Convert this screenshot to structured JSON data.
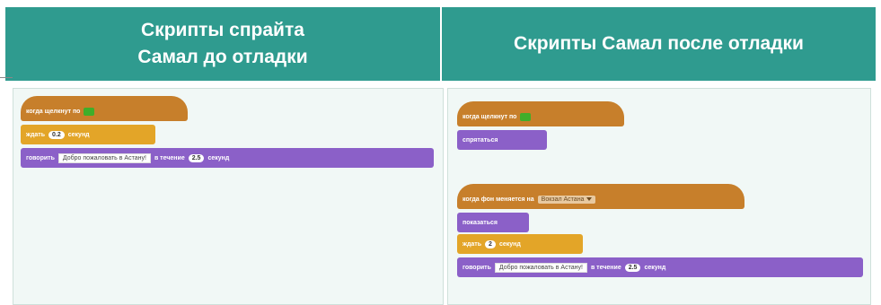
{
  "headers": {
    "left_line1": "Скрипты спрайта",
    "left_line2": "Самал до отладки",
    "right": "Скрипты Самал после отладки"
  },
  "left_script": {
    "hat_label": "когда щелкнут по",
    "wait_label": "ждать",
    "wait_value": "0.2",
    "wait_unit": "секунд",
    "say_label": "говорить",
    "say_text": "Добро пожаловать в Астану!",
    "say_during": "в течение",
    "say_value": "2.5",
    "say_unit": "секунд"
  },
  "right_script": {
    "hat_label": "когда щелкнут по",
    "hide_label": "спрятаться",
    "backdrop_hat_label": "когда фон меняется на",
    "backdrop_value": "Вокзал Астана",
    "show_label": "показаться",
    "wait_label": "ждать",
    "wait_value": "2",
    "wait_unit": "секунд",
    "say_label": "говорить",
    "say_text": "Добро пожаловать в Астану!",
    "say_during": "в течение",
    "say_value": "2.5",
    "say_unit": "секунд"
  },
  "colors": {
    "header": "#2f9b8f",
    "events": "#c77f2b",
    "control": "#e3a528",
    "looks": "#8b60c8",
    "flag": "#3fae2a"
  }
}
